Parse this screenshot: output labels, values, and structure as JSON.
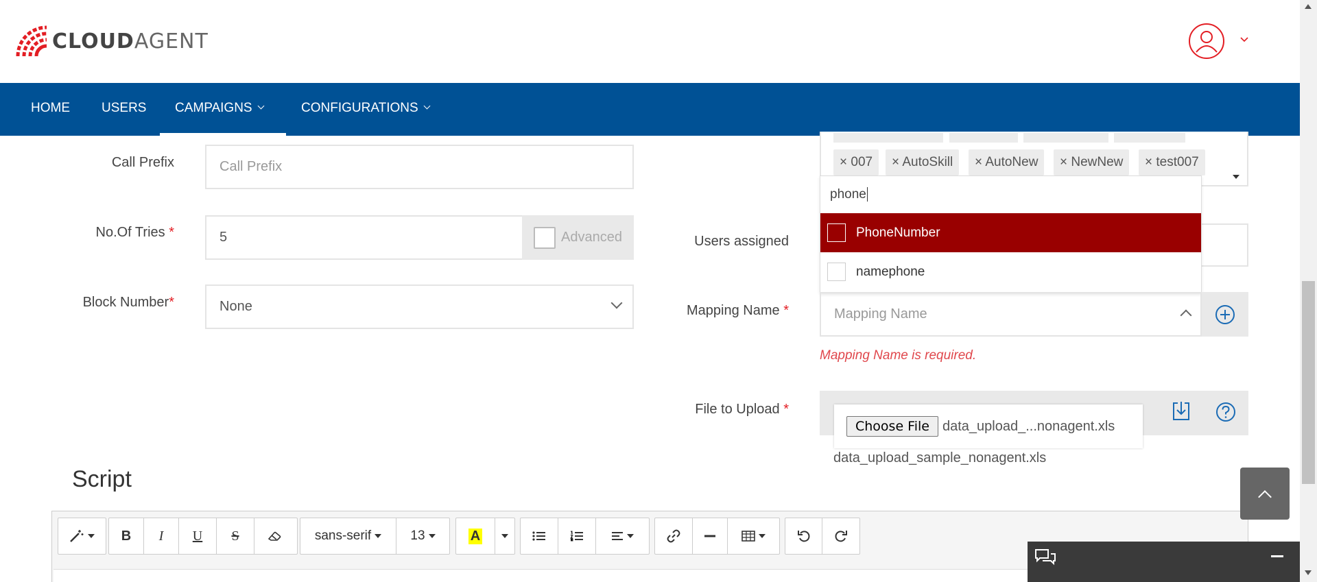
{
  "brand": {
    "logo_cloud": "CLOUD",
    "logo_agent": "AGENT",
    "accent_color": "#e31e24",
    "nav_color": "#005195"
  },
  "nav": {
    "items": [
      {
        "label": "HOME"
      },
      {
        "label": "USERS"
      },
      {
        "label": "CAMPAIGNS"
      },
      {
        "label": "CONFIGURATIONS"
      }
    ],
    "active": "CAMPAIGNS"
  },
  "form": {
    "call_prefix": {
      "label": "Call Prefix",
      "placeholder": "Call Prefix"
    },
    "no_of_tries": {
      "label": "No.Of Tries",
      "required_mark": "*",
      "value": "5",
      "advanced_label": "Advanced"
    },
    "block_number": {
      "label": "Block Number",
      "required_mark": "*",
      "value": "None"
    },
    "users_assigned": {
      "label": "Users assigned"
    },
    "mapping_name": {
      "label": "Mapping Name",
      "required_mark": "*",
      "placeholder": "Mapping Name",
      "error": "Mapping Name is required."
    },
    "file_upload": {
      "label": "File to Upload",
      "required_mark": "*",
      "button_label": "Choose File",
      "file_display": "data_upload_...nonagent.xls",
      "sample_file": "data_upload_sample_nonagent.xls"
    }
  },
  "skills_tags": [
    "× 007",
    "× AutoSkill",
    "× AutoNew",
    "× NewNew",
    "× test007"
  ],
  "mapping_dropdown": {
    "search_value": "phone",
    "options": [
      {
        "label": "PhoneNumber",
        "selected": true
      },
      {
        "label": "namephone",
        "selected": false
      }
    ],
    "selected_color": "#990000"
  },
  "script": {
    "title": "Script",
    "toolbar": {
      "font_family": "sans-serif",
      "font_size": "13",
      "bold": "B",
      "italic": "I",
      "underline": "U",
      "strike": "S",
      "highlight": "A"
    }
  }
}
